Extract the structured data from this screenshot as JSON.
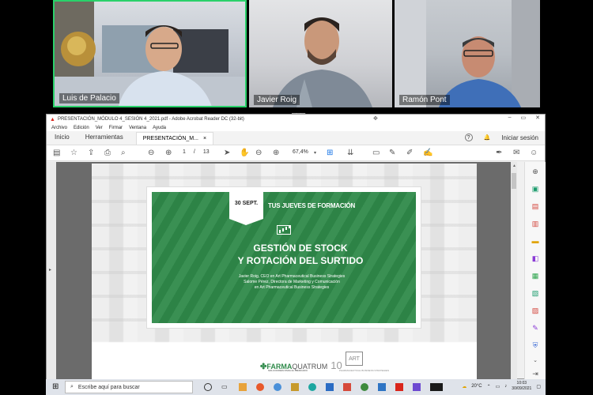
{
  "participants": [
    {
      "name": "Luis de Palacio",
      "active": true
    },
    {
      "name": "Javier Roig",
      "active": false
    },
    {
      "name": "Ramón Pont",
      "active": false
    }
  ],
  "window": {
    "title": "PRESENTACIÓN_MÓDULO 4_SESIÓN 4_2021.pdf - Adobe Acrobat Reader DC (32-bit)",
    "controls": [
      "–",
      "▭",
      "✕"
    ]
  },
  "menu": [
    "Archivo",
    "Edición",
    "Ver",
    "Firmar",
    "Ventana",
    "Ayuda"
  ],
  "tabs": {
    "home": "Inicio",
    "tools": "Herramientas",
    "doc": "PRESENTACIÓN_M...",
    "doc_close": "×",
    "help": "?",
    "bell": "🔔",
    "signin": "Iniciar sesión"
  },
  "toolbar": {
    "page_current": "1",
    "page_sep": "/",
    "page_total": "13",
    "zoom": "67,4%"
  },
  "slide": {
    "date": "30 SEPT.",
    "kicker": "TUS JUEVES DE FORMACIÓN",
    "title_line1": "GESTIÓN DE STOCK",
    "title_line2": "Y ROTACIÓN DEL  SURTIDO",
    "speaker1": "Javier Roig, CEO en Art Pharmaceutical Business Strategies",
    "speaker2": "Salome Pérez, Directora de Marketing y Comunicación",
    "speaker3": "en Art Pharmaceutical Business Strategies",
    "logo1_main": "FARMA",
    "logo1_second": "QUATRUM",
    "logo1_ten": "10",
    "logo1_sub": "SOLUCIONES PARA EL MERCADO",
    "logo2_mark": "ART",
    "logo2_sub": "PHARMACEUTICAL BUSINESS STRATEGIES"
  },
  "taskbar": {
    "search_placeholder": "Escribe aquí para buscar",
    "weather": "20°C",
    "time": "10:03",
    "date": "30/09/2021"
  },
  "colors": {
    "slide_green": "#2f8a4a",
    "active_speaker": "#2ad16a"
  }
}
